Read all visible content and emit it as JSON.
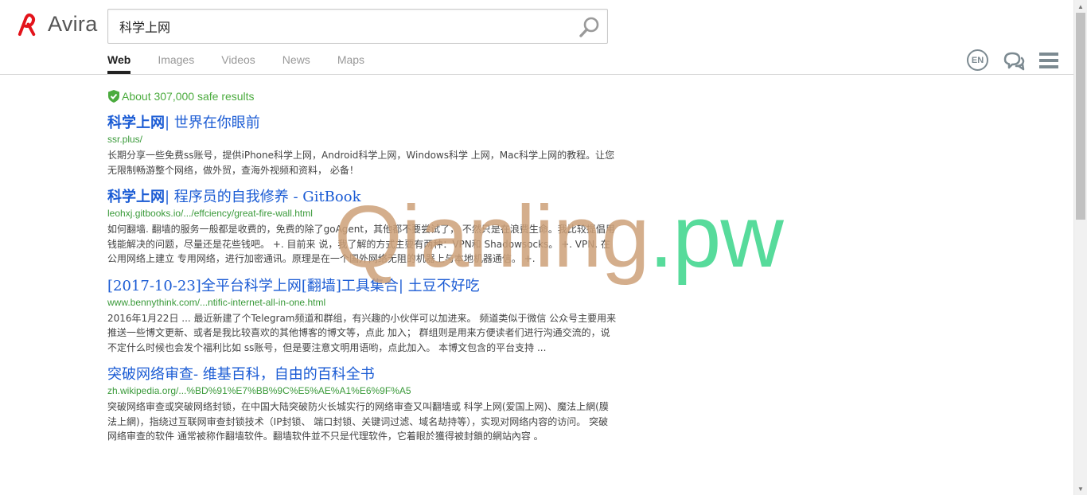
{
  "header": {
    "brand": "Avira",
    "search": {
      "value": "科学上网",
      "placeholder": ""
    },
    "tabs": [
      {
        "label": "Web",
        "active": true
      },
      {
        "label": "Images",
        "active": false
      },
      {
        "label": "Videos",
        "active": false
      },
      {
        "label": "News",
        "active": false
      },
      {
        "label": "Maps",
        "active": false
      }
    ],
    "lang": "EN",
    "icons": {
      "brand": "avira-umbrella-icon",
      "search": "search-icon",
      "chat": "chat-bubbles-icon",
      "menu": "hamburger-menu-icon",
      "safe": "green-shield-check-icon"
    }
  },
  "results": {
    "count_text": "About 307,000 safe results",
    "items": [
      {
        "title_bold": "科学上网",
        "title_rest": "| 世界在你眼前",
        "url": "ssr.plus/",
        "desc": "长期分享一些免费ss账号，提供iPhone科学上网，Android科学上网，Windows科学 上网，Mac科学上网的教程。让您无限制畅游整个网络，做外贸，查海外视频和资料， 必备！"
      },
      {
        "title_bold": "科学上网",
        "title_rest": "| 程序员的自我修养 - GitBook",
        "url": "leohxj.gitbooks.io/.../effciency/great-fire-wall.html",
        "desc": "如何翻墙. 翻墙的服务一般都是收费的，免费的除了goAgent，其他都不要尝试了， 不然只是在浪费生命。我比较提倡用钱能解决的问题，尽量还是花些钱吧。 +. 目前来 说，我了解的方式主要有两种：VPN和 Shadowsocks。 +. VPN. 在公用网络上建立 专用网络，进行加密通讯。原理是在一个国外网络无阻的机器上与本地机器通信。 +."
      },
      {
        "title_bold": "",
        "title_rest": "[2017-10-23]全平台科学上网[翻墙]工具集合| 土豆不好吃",
        "url": "www.bennythink.com/...ntific-internet-all-in-one.html",
        "desc": "2016年1月22日 ... 最近新建了个Telegram频道和群组，有兴趣的小伙伴可以加进来。 频道类似于微信 公众号主要用来推送一些博文更新、或者是我比较喜欢的其他博客的博文等，点此 加入； 群组则是用来方便读者们进行沟通交流的，说不定什么时候也会发个福利比如 ss账号，但是要注意文明用语哟，点此加入。 本博文包含的平台支持 ..."
      },
      {
        "title_bold": "",
        "title_rest": "突破网络审查- 维基百科，自由的百科全书",
        "url": "zh.wikipedia.org/...%BD%91%E7%BB%9C%E5%AE%A1%E6%9F%A5",
        "desc": "突破网络审查或突破网络封锁，在中国大陆突破防火长城实行的网络审查又叫翻墙或 科学上网(爱国上网)、魔法上網(膜法上網)，指绕过互联网审查封锁技术（IP封锁、 端口封锁、关键词过滤、域名劫持等），实现对网络内容的访问。 突破网络审查的软件 通常被称作翻墙软件。翻墙软件並不只是代理软件，它着眼於獲得被封鎖的網站內容 。"
      }
    ]
  },
  "watermark": {
    "part1": "Qianling",
    "part2": ".pw"
  }
}
